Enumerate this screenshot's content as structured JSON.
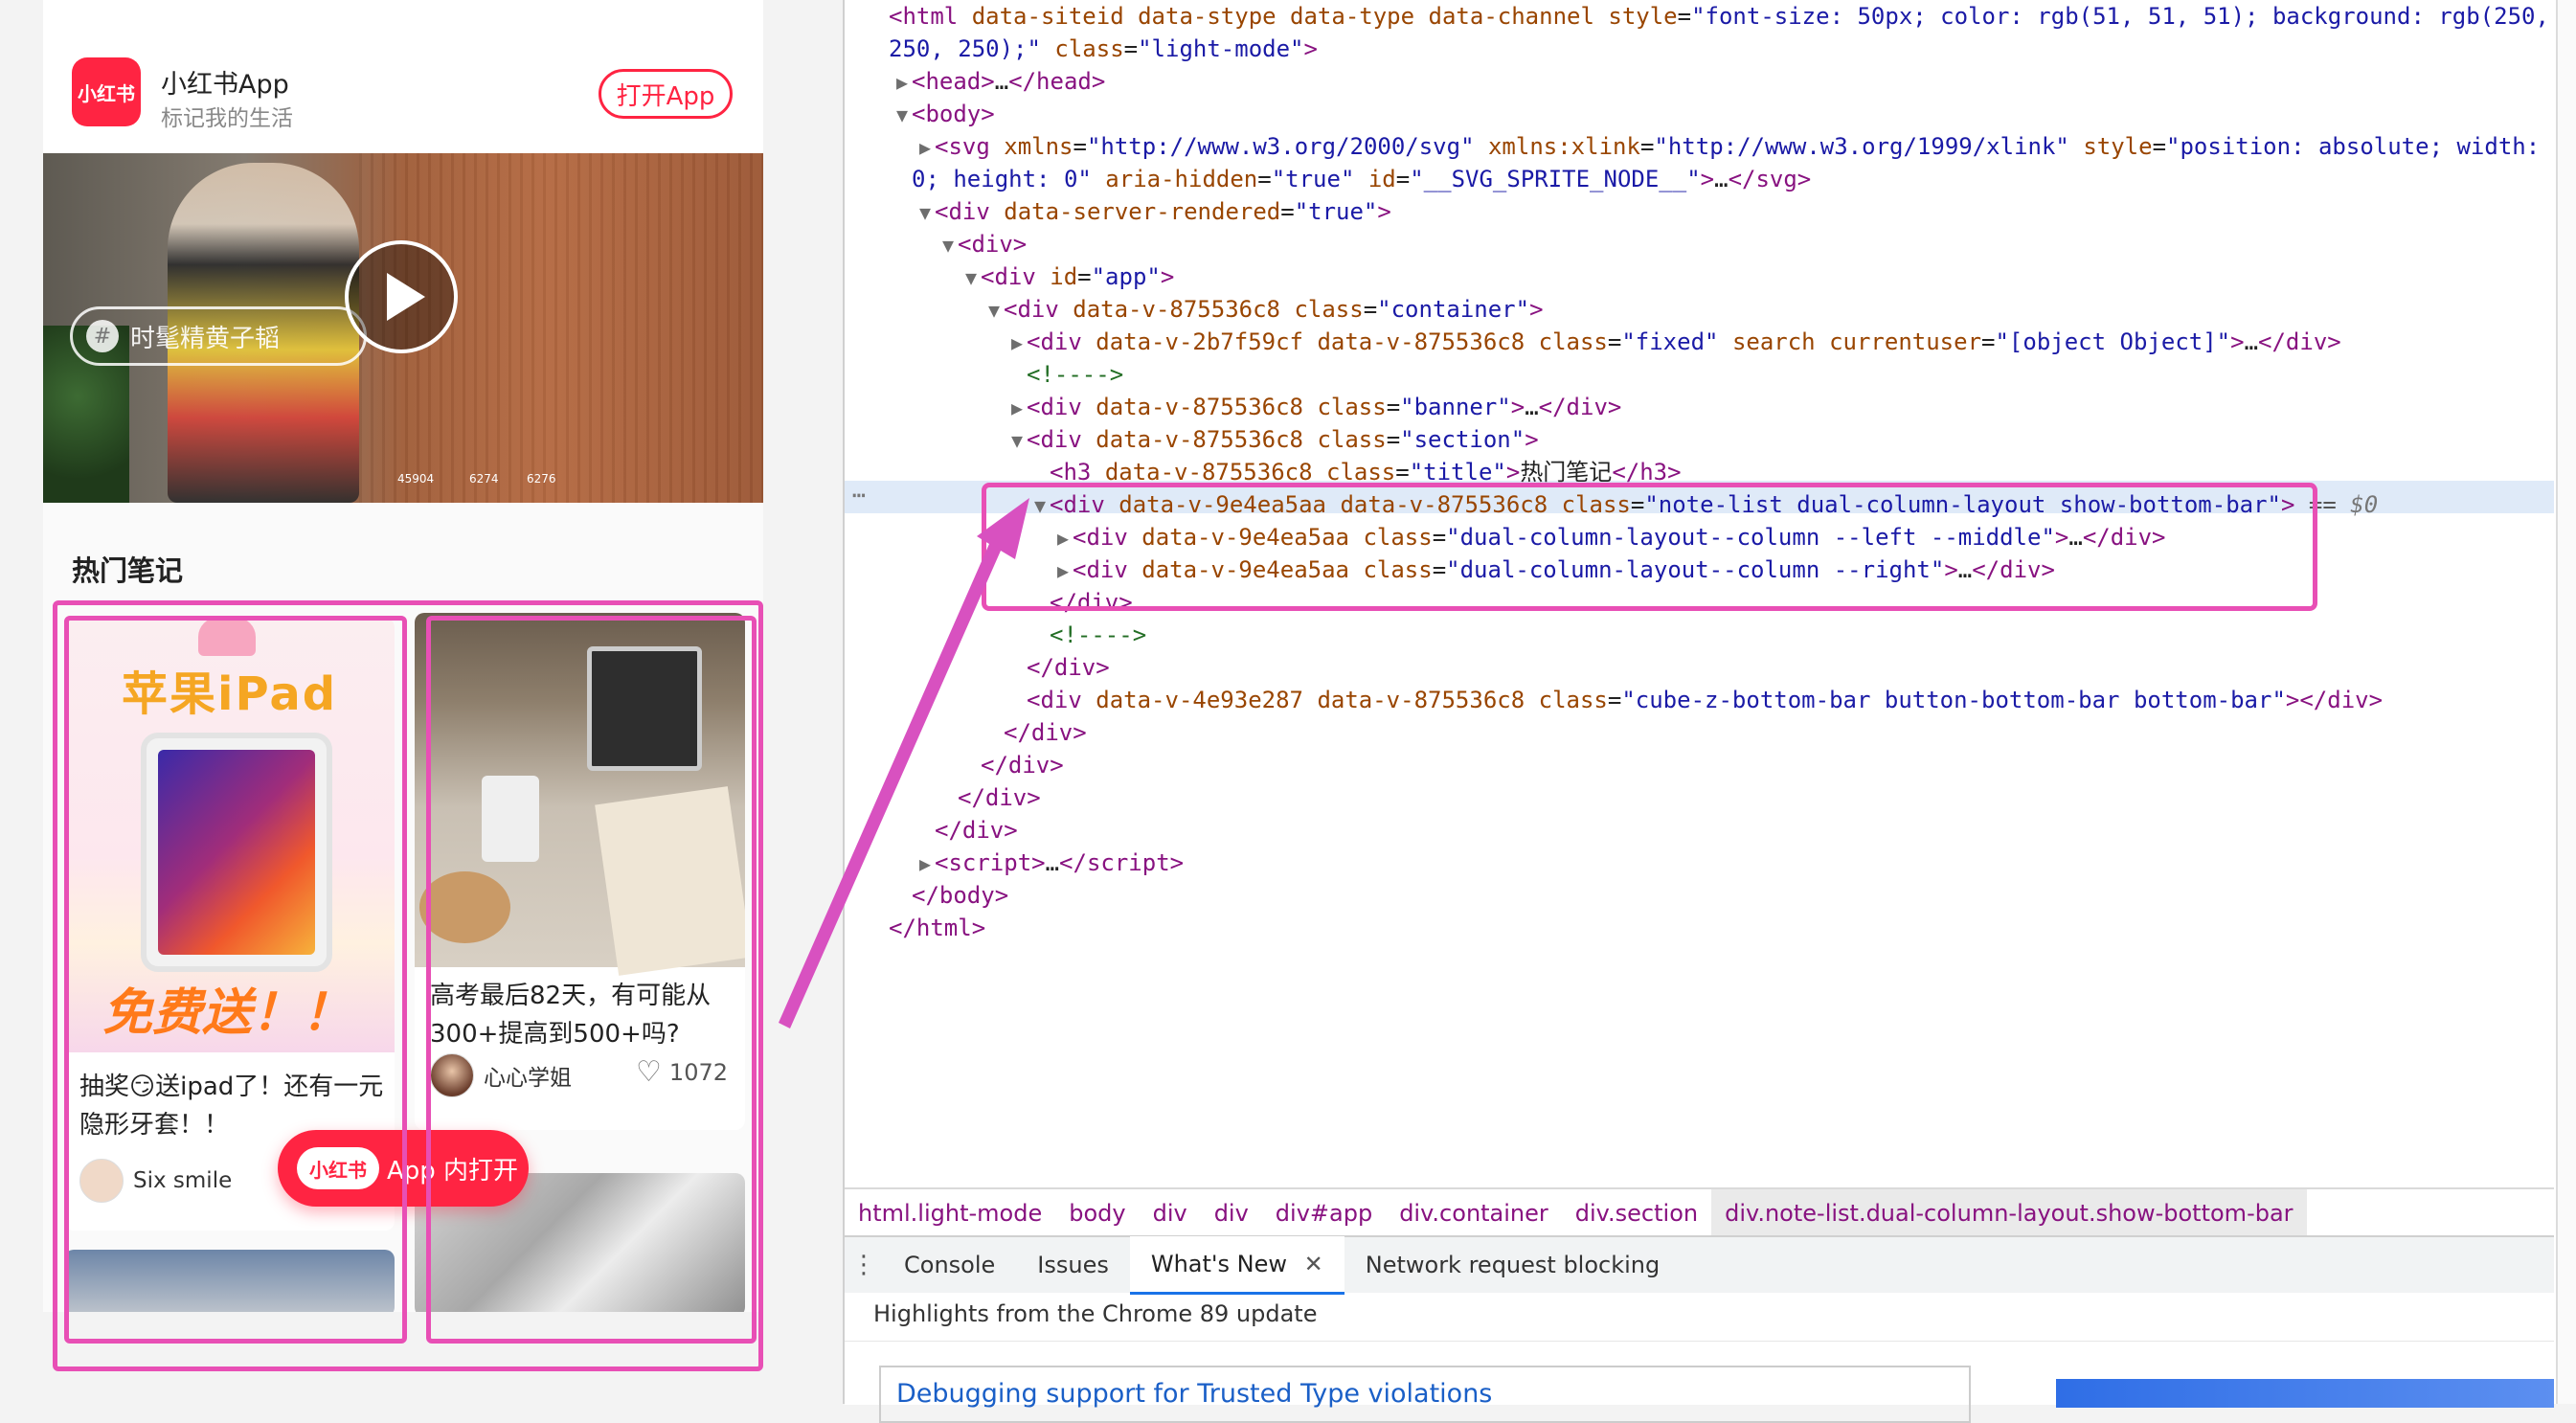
{
  "app_header": {
    "logo_text": "小红书",
    "app_name": "小红书App",
    "slogan": "标记我的生活",
    "open_button": "打开App"
  },
  "banner": {
    "tag_icon": "#",
    "tag_label": "时髦精黄子韬",
    "stats": [
      "45904",
      "6274",
      "6276"
    ]
  },
  "section": {
    "title": "热门笔记",
    "notes": [
      {
        "cover_title": "苹果iPad",
        "cover_subtitle": "免费送！！",
        "title": "抽奖😏送ipad了！还有一元隐形牙套！！",
        "author": "Six smile"
      },
      {
        "title": "高考最后82天，有可能从300+提高到500+吗?",
        "author": "心心学姐",
        "likes": "1072"
      }
    ]
  },
  "float_button": {
    "logo_text": "小红书",
    "label": "App 内打开"
  },
  "devtools": {
    "dom_lines": [
      {
        "indent": 0,
        "tri": "",
        "html": "<span class=\"tag\">&lt;html</span> <span class=\"attr\">data-siteid data-stype data-type data-channel style</span>=<span class=\"val\">\"font-size: 50px; color: rgb(51, 51, 51); background: rgb(250,</span>"
      },
      {
        "indent": 0,
        "tri": "",
        "html": "<span class=\"val\">250, 250);\"</span> <span class=\"attr\">class</span>=<span class=\"val\">\"light-mode\"</span><span class=\"tag\">&gt;</span>"
      },
      {
        "indent": 1,
        "tri": "▶",
        "html": "<span class=\"tag\">&lt;head&gt;</span>…<span class=\"tag\">&lt;/head&gt;</span>"
      },
      {
        "indent": 1,
        "tri": "▼",
        "html": "<span class=\"tag\">&lt;body&gt;</span>"
      },
      {
        "indent": 2,
        "tri": "▶",
        "html": "<span class=\"tag\">&lt;svg</span> <span class=\"attr\">xmlns</span>=<span class=\"val\">\"http://www.w3.org/2000/svg\"</span> <span class=\"attr\">xmlns:xlink</span>=<span class=\"val\">\"http://www.w3.org/1999/xlink\"</span> <span class=\"attr\">style</span>=<span class=\"val\">\"position: absolute; width:</span>"
      },
      {
        "indent": 1,
        "tri": "",
        "html": "<span class=\"val\">0; height: 0\"</span> <span class=\"attr\">aria-hidden</span>=<span class=\"val\">\"true\"</span> <span class=\"attr\">id</span>=<span class=\"val\">\"__SVG_SPRITE_NODE__\"</span><span class=\"tag\">&gt;</span>…<span class=\"tag\">&lt;/svg&gt;</span>"
      },
      {
        "indent": 2,
        "tri": "▼",
        "html": "<span class=\"tag\">&lt;div</span> <span class=\"attr\">data-server-rendered</span>=<span class=\"val\">\"true\"</span><span class=\"tag\">&gt;</span>"
      },
      {
        "indent": 3,
        "tri": "▼",
        "html": "<span class=\"tag\">&lt;div&gt;</span>"
      },
      {
        "indent": 4,
        "tri": "▼",
        "html": "<span class=\"tag\">&lt;div</span> <span class=\"attr\">id</span>=<span class=\"val\">\"app\"</span><span class=\"tag\">&gt;</span>"
      },
      {
        "indent": 5,
        "tri": "▼",
        "html": "<span class=\"tag\">&lt;div</span> <span class=\"attr\">data-v-875536c8 class</span>=<span class=\"val\">\"container\"</span><span class=\"tag\">&gt;</span>"
      },
      {
        "indent": 6,
        "tri": "▶",
        "html": "<span class=\"tag\">&lt;div</span> <span class=\"attr\">data-v-2b7f59cf data-v-875536c8 class</span>=<span class=\"val\">\"fixed\"</span> <span class=\"attr\">search currentuser</span>=<span class=\"val\">\"[object Object]\"</span><span class=\"tag\">&gt;</span>…<span class=\"tag\">&lt;/div&gt;</span>"
      },
      {
        "indent": 6,
        "tri": "",
        "html": "<span class=\"cmt\">&lt;!----&gt;</span>"
      },
      {
        "indent": 6,
        "tri": "▶",
        "html": "<span class=\"tag\">&lt;div</span> <span class=\"attr\">data-v-875536c8 class</span>=<span class=\"val\">\"banner\"</span><span class=\"tag\">&gt;</span>…<span class=\"tag\">&lt;/div&gt;</span>"
      },
      {
        "indent": 6,
        "tri": "▼",
        "html": "<span class=\"tag\">&lt;div</span> <span class=\"attr\">data-v-875536c8 class</span>=<span class=\"val\">\"section\"</span><span class=\"tag\">&gt;</span>"
      },
      {
        "indent": 7,
        "tri": "",
        "html": "<span class=\"tag\">&lt;h3</span> <span class=\"attr\">data-v-875536c8 class</span>=<span class=\"val\">\"title\"</span><span class=\"tag\">&gt;</span>热门笔记<span class=\"tag\">&lt;/h3&gt;</span>"
      },
      {
        "indent": 7,
        "tri": "▼",
        "html": "<span class=\"tag\">&lt;div</span> <span class=\"attr\">data-v-9e4ea5aa data-v-875536c8 class</span>=<span class=\"val\">\"note-list dual-column-layout show-bottom-bar\"</span><span class=\"tag\">&gt;</span> <span style=\"color:#555\">==</span> <i style=\"color:#777\">$0</i>"
      },
      {
        "indent": 8,
        "tri": "▶",
        "html": "<span class=\"tag\">&lt;div</span> <span class=\"attr\">data-v-9e4ea5aa class</span>=<span class=\"val\">\"dual-column-layout--column --left --middle\"</span><span class=\"tag\">&gt;</span>…<span class=\"tag\">&lt;/div&gt;</span>"
      },
      {
        "indent": 8,
        "tri": "▶",
        "html": "<span class=\"tag\">&lt;div</span> <span class=\"attr\">data-v-9e4ea5aa class</span>=<span class=\"val\">\"dual-column-layout--column --right\"</span><span class=\"tag\">&gt;</span>…<span class=\"tag\">&lt;/div&gt;</span>"
      },
      {
        "indent": 7,
        "tri": "",
        "html": "<span class=\"tag\">&lt;/div&gt;</span>"
      },
      {
        "indent": 7,
        "tri": "",
        "html": "<span class=\"cmt\">&lt;!----&gt;</span>"
      },
      {
        "indent": 6,
        "tri": "",
        "html": "<span class=\"tag\">&lt;/div&gt;</span>"
      },
      {
        "indent": 6,
        "tri": "",
        "html": "<span class=\"tag\">&lt;div</span> <span class=\"attr\">data-v-4e93e287 data-v-875536c8 class</span>=<span class=\"val\">\"cube-z-bottom-bar button-bottom-bar bottom-bar\"</span><span class=\"tag\">&gt;&lt;/div&gt;</span>"
      },
      {
        "indent": 5,
        "tri": "",
        "html": "<span class=\"tag\">&lt;/div&gt;</span>"
      },
      {
        "indent": 4,
        "tri": "",
        "html": "<span class=\"tag\">&lt;/div&gt;</span>"
      },
      {
        "indent": 3,
        "tri": "",
        "html": "<span class=\"tag\">&lt;/div&gt;</span>"
      },
      {
        "indent": 2,
        "tri": "",
        "html": "<span class=\"tag\">&lt;/div&gt;</span>"
      },
      {
        "indent": 2,
        "tri": "▶",
        "html": "<span class=\"tag\">&lt;script&gt;</span>…<span class=\"tag\">&lt;/script&gt;</span>"
      },
      {
        "indent": 1,
        "tri": "",
        "html": "<span class=\"tag\">&lt;/body&gt;</span>"
      },
      {
        "indent": 0,
        "tri": "",
        "html": "<span class=\"tag\">&lt;/html&gt;</span>"
      }
    ],
    "breadcrumbs": [
      "html.light-mode",
      "body",
      "div",
      "div",
      "div#app",
      "div.container",
      "div.section",
      "div.note-list.dual-column-layout.show-bottom-bar"
    ],
    "drawer_tabs": [
      "Console",
      "Issues",
      "What's New",
      "Network request blocking"
    ],
    "active_tab": "What's New",
    "whats_new_subtitle": "Highlights from the Chrome 89 update",
    "article_title": "Debugging support for Trusted Type violations"
  }
}
